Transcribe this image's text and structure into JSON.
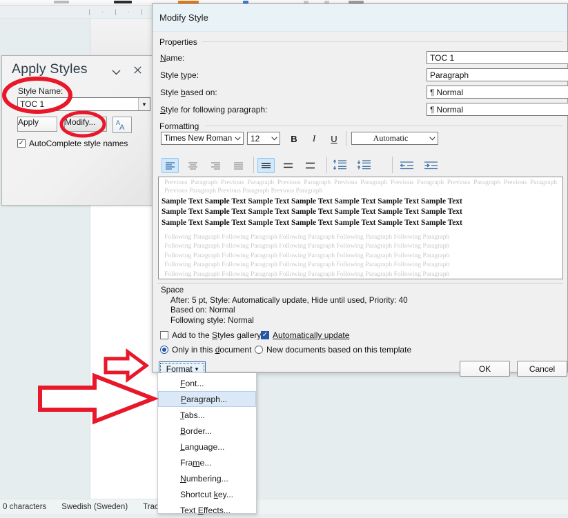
{
  "word_window": {
    "ruler_ticks": [
      "|",
      "·",
      "|",
      "·",
      "|",
      "·",
      "|",
      "·",
      "|",
      "·",
      "|",
      "·",
      "|"
    ],
    "statusbar": {
      "characters": "0 characters",
      "language": "Swedish (Sweden)",
      "track_changes": "Track C"
    }
  },
  "apply_styles_panel": {
    "title": "Apply Styles",
    "collapse_icon": "chevron-down-icon",
    "close_icon": "close-icon",
    "style_name_label": "Style Name:",
    "style_name_value": "TOC 1",
    "dropdown_icon": "triangle-down-icon",
    "apply_label": "Apply",
    "modify_label": "Modify...",
    "style_inspector_icon": "style-inspector-icon",
    "autocomplete_label": "AutoComplete style names",
    "autocomplete_checked": true
  },
  "dialog": {
    "title": "Modify Style",
    "help_icon": "question-mark-icon",
    "close_icon": "close-icon",
    "groups": {
      "properties": "Properties",
      "formatting": "Formatting"
    },
    "fields": [
      {
        "label": "Name:",
        "value": "TOC 1",
        "type": "text"
      },
      {
        "label": "Style type:",
        "value": "Paragraph",
        "type": "combo"
      },
      {
        "label": "Style based on:",
        "value": "Normal",
        "type": "combo",
        "pilcrow": true
      },
      {
        "label": "Style for following paragraph:",
        "value": "Normal",
        "type": "combo",
        "pilcrow": true
      }
    ],
    "formatting": {
      "font_family": "Times New Roman",
      "font_size": "12",
      "bold": "B",
      "italic": "I",
      "underline": "U",
      "font_color": "Automatic",
      "align_buttons": [
        {
          "name": "align-left-button",
          "selected": true
        },
        {
          "name": "align-center-button",
          "selected": false
        },
        {
          "name": "align-right-button",
          "selected": false
        },
        {
          "name": "align-justify-button",
          "selected": false
        }
      ],
      "line_spacing_buttons": [
        {
          "name": "line-spacing-single-button",
          "selected": true
        },
        {
          "name": "line-spacing-1-5-button",
          "selected": false
        },
        {
          "name": "line-spacing-double-button",
          "selected": false
        }
      ],
      "space_buttons": [
        {
          "name": "decrease-space-before-button",
          "selected": false
        },
        {
          "name": "increase-space-after-button",
          "selected": false
        }
      ],
      "indent_buttons": [
        {
          "name": "decrease-indent-button",
          "selected": false
        },
        {
          "name": "increase-indent-button",
          "selected": false
        }
      ]
    },
    "preview": {
      "previous_paragraph": "Previous Paragraph Previous Paragraph Previous Paragraph Previous Paragraph Previous Paragraph Previous Paragraph Previous Paragraph Previous Paragraph Previous Paragraph Previous Paragraph",
      "sample_line": "Sample Text Sample Text Sample Text Sample Text Sample Text Sample Text Sample Text",
      "following_line": "Following Paragraph Following Paragraph Following Paragraph Following Paragraph Following Paragraph"
    },
    "description": {
      "line1": "Space",
      "line2": "After:  5 pt, Style: Automatically update, Hide until used, Priority: 40",
      "line3": "Based on: Normal",
      "line4": "Following style: Normal"
    },
    "options": {
      "add_to_gallery": {
        "label": "Add to the Styles gallery",
        "checked": false
      },
      "auto_update": {
        "label": "Automatically update",
        "checked": true
      },
      "only_this_document": {
        "label": "Only in this document",
        "selected": true
      },
      "new_documents": {
        "label": "New documents based on this template",
        "selected": false
      }
    },
    "buttons": {
      "format": "Format",
      "format_caret": "▾",
      "ok": "OK",
      "cancel": "Cancel"
    }
  },
  "format_menu": {
    "items": [
      {
        "label": "Font...",
        "highlighted": false
      },
      {
        "label": "Paragraph...",
        "highlighted": true
      },
      {
        "label": "Tabs...",
        "highlighted": false
      },
      {
        "label": "Border...",
        "highlighted": false
      },
      {
        "label": "Language...",
        "highlighted": false
      },
      {
        "label": "Frame...",
        "highlighted": false
      },
      {
        "label": "Numbering...",
        "highlighted": false
      },
      {
        "label": "Shortcut key...",
        "highlighted": false
      },
      {
        "label": "Text Effects...",
        "highlighted": false
      }
    ]
  },
  "annotations": {
    "color": "#e8172a",
    "ellipse_style_name": "ellipse around Style Name label and TOC 1 field",
    "ellipse_modify": "ellipse around Modify... button",
    "arrow_format": "arrow pointing to Format button",
    "arrow_paragraph": "arrow pointing to Paragraph menu item"
  }
}
